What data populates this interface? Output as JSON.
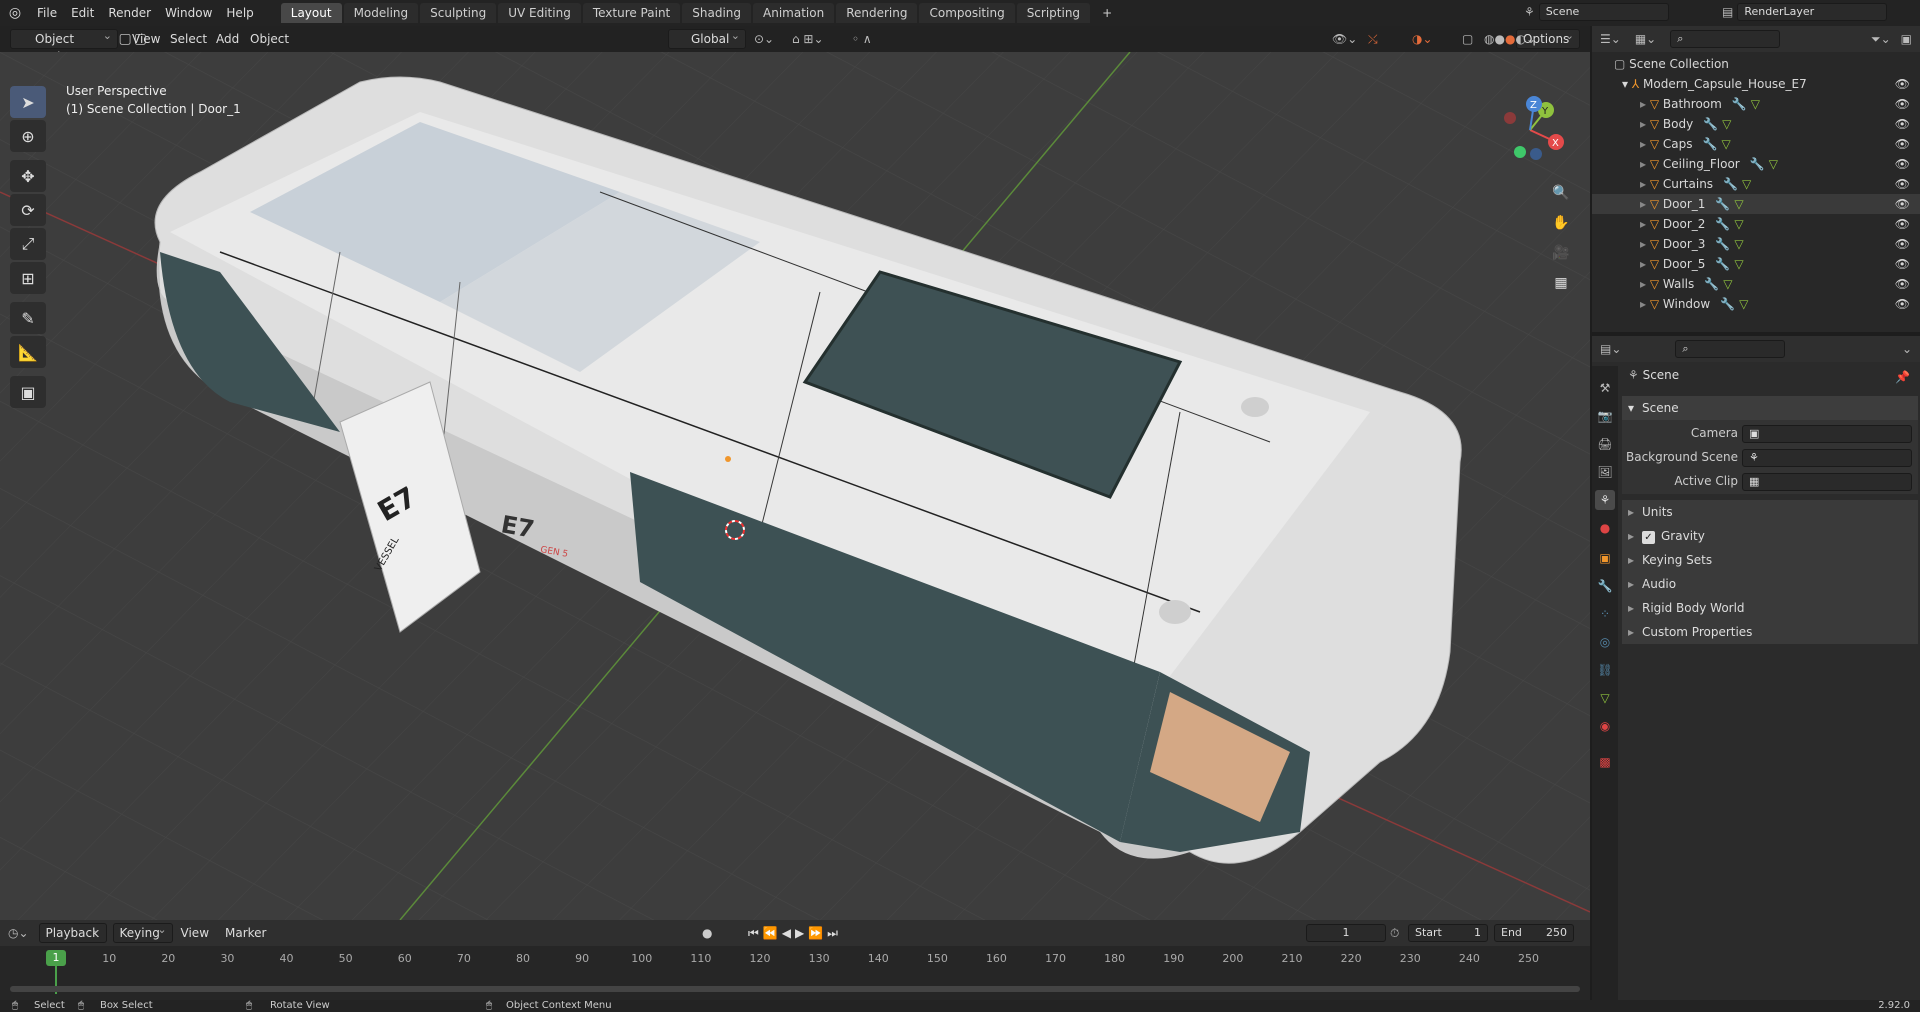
{
  "menu": {
    "file": "File",
    "edit": "Edit",
    "render": "Render",
    "window": "Window",
    "help": "Help"
  },
  "workspaces": [
    "Layout",
    "Modeling",
    "Sculpting",
    "UV Editing",
    "Texture Paint",
    "Shading",
    "Animation",
    "Rendering",
    "Compositing",
    "Scripting"
  ],
  "active_workspace": "Layout",
  "scene_field": "Scene",
  "view_layer_field": "RenderLayer",
  "viewport": {
    "mode": "Object Mode",
    "menus": [
      "View",
      "Select",
      "Add",
      "Object"
    ],
    "transform_orientation": "Global",
    "options": "Options",
    "overlay_title": "User Perspective",
    "overlay_sub": "(1) Scene Collection | Door_1",
    "gizmo": {
      "x": "X",
      "y": "Y",
      "z": "Z"
    }
  },
  "outliner": {
    "root": "Scene Collection",
    "collection": "Modern_Capsule_House_E7",
    "objects": [
      "Bathroom",
      "Body",
      "Caps",
      "Ceiling_Floor",
      "Curtains",
      "Door_1",
      "Door_2",
      "Door_3",
      "Door_5",
      "Walls",
      "Window"
    ],
    "selected": "Door_1"
  },
  "properties": {
    "context": "Scene",
    "panel_title": "Scene",
    "camera_label": "Camera",
    "background_scene_label": "Background Scene",
    "active_clip_label": "Active Clip",
    "subpanels": [
      "Units",
      "Gravity",
      "Keying Sets",
      "Audio",
      "Rigid Body World",
      "Custom Properties"
    ],
    "gravity_checked": true
  },
  "timeline": {
    "menus": [
      "Playback",
      "Keying",
      "View",
      "Marker"
    ],
    "current_frame": "1",
    "start_label": "Start",
    "start": "1",
    "end_label": "End",
    "end": "250",
    "ticks": [
      "10",
      "20",
      "30",
      "40",
      "50",
      "60",
      "70",
      "80",
      "90",
      "100",
      "110",
      "120",
      "130",
      "140",
      "150",
      "160",
      "170",
      "180",
      "190",
      "200",
      "210",
      "220",
      "230",
      "240",
      "250"
    ],
    "playhead": "1"
  },
  "statusbar": {
    "select": "Select",
    "box_select": "Box Select",
    "rotate_view": "Rotate View",
    "context_menu": "Object Context Menu",
    "version": "2.92.0"
  },
  "model_decals": {
    "e7_door": "E7",
    "gen": "GEN 5",
    "vessel": "VESSEL"
  },
  "colors": {
    "accent": "#4772b3",
    "selected_orange": "#f0962c",
    "x_axis": "#e44a4a",
    "y_axis": "#8fc23e",
    "z_axis": "#4a86d6"
  }
}
